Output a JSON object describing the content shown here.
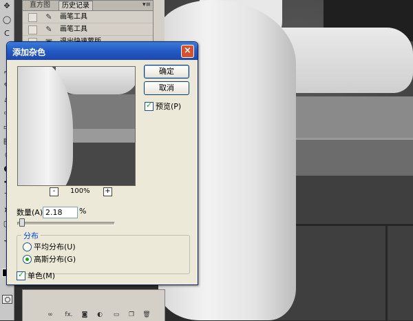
{
  "history_panel": {
    "tabs": [
      "直方图",
      "历史记录"
    ],
    "active_tab": 1,
    "menu_glyph": "▾≡",
    "steps": [
      {
        "label": "画笔工具",
        "icon": "brush-icon"
      },
      {
        "label": "画笔工具",
        "icon": "brush-icon"
      },
      {
        "label": "退出快速蒙版",
        "icon": "quickmask-icon"
      }
    ]
  },
  "toolbar": {
    "tools": [
      "move-icon",
      "lasso-icon",
      "lasso-icon",
      "crop-icon",
      "brush-icon",
      "stamp-icon",
      "history-brush-icon",
      "eraser-icon",
      "gradient-icon",
      "blur-icon",
      "dodge-icon",
      "pen-icon",
      "type-icon",
      "path-select-icon",
      "shape-icon",
      "hand-icon"
    ]
  },
  "dialog": {
    "title": "添加杂色",
    "close_glyph": "×",
    "ok_label": "确定",
    "cancel_label": "取消",
    "preview_checkbox": {
      "label": "预览(P)",
      "checked": true
    },
    "zoom": {
      "minus": "-",
      "plus": "+",
      "value": "100%"
    },
    "amount": {
      "label": "数量(A):",
      "value": "2.18",
      "unit": "%"
    },
    "slider_fraction": 0.02,
    "distribution": {
      "title": "分布",
      "options": [
        {
          "label": "平均分布(U)",
          "selected": false
        },
        {
          "label": "高斯分布(G)",
          "selected": true
        }
      ]
    },
    "monochrome": {
      "label": "单色(M)",
      "checked": true
    }
  },
  "layers_panel": {
    "buttons": [
      "link-icon",
      "fx-icon",
      "mask-icon",
      "adjustment-icon",
      "group-icon",
      "new-layer-icon",
      "trash-icon"
    ],
    "fx_label": "fx."
  },
  "colors": {
    "titlebar": "#2459c4",
    "dialog_bg": "#ece9d8",
    "accent_green": "#21a121"
  }
}
